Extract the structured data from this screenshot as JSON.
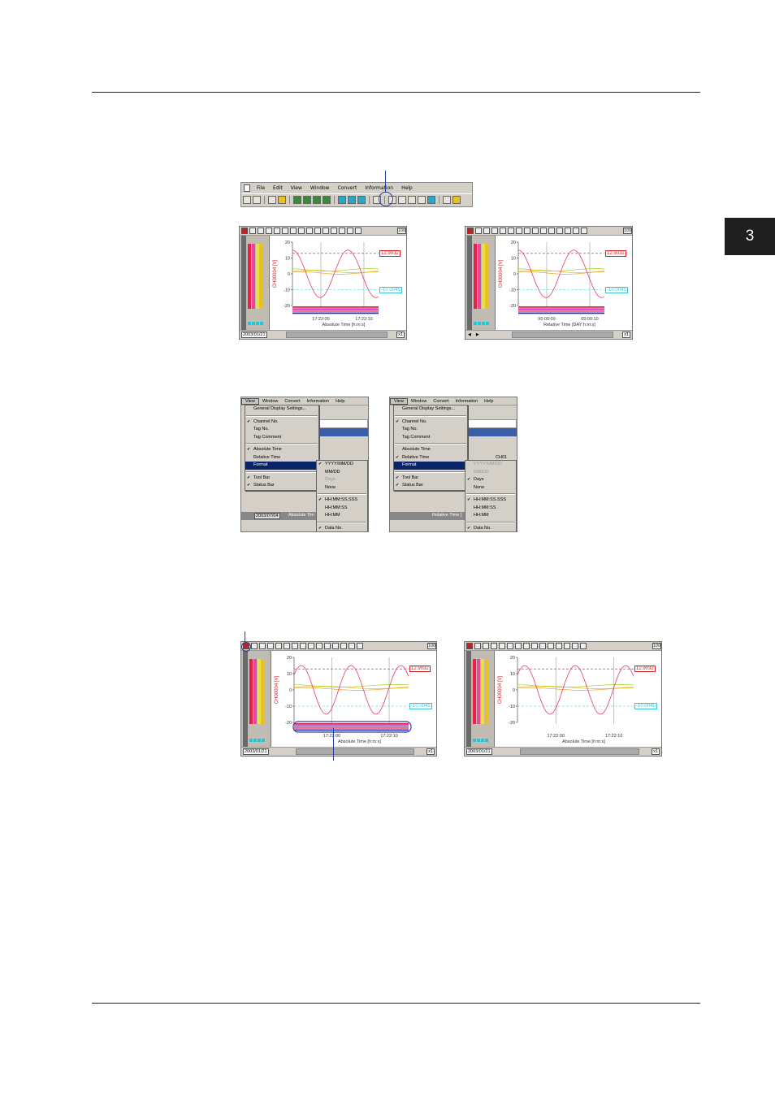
{
  "chapter": "3",
  "menubar": {
    "items": [
      "File",
      "Edit",
      "View",
      "Window",
      "Convert",
      "Information",
      "Help"
    ]
  },
  "panels": {
    "rate": "100msec",
    "y_unit_label": "CH00004 [V]",
    "y_ticks": [
      "20",
      "10",
      "0",
      "-10",
      "-20"
    ],
    "upper_value": "12.9032",
    "lower_value": "-10.0045",
    "date": "2003/01/21",
    "zoom": "x1",
    "abs": {
      "ticks": [
        "17:22:00",
        "17:22:10"
      ],
      "xlabel": "Absolute Time [h:m:s]"
    },
    "rel": {
      "ticks": [
        "00:00:00",
        "00:00:10"
      ],
      "xlabel": "Relative Time [DAY h:m:s]"
    },
    "lower_left_value": "-10.0045"
  },
  "menus": {
    "top_items": [
      "View",
      "Window",
      "Convert",
      "Information",
      "Help"
    ],
    "view_items": [
      "General Display Settings...",
      "Channel No.",
      "Tag No.",
      "Tag Comment",
      "Absolute Time",
      "Relative Time",
      "Format",
      "Tool Bar",
      "Status Bar"
    ],
    "format_items": [
      "YYYY/MM/DD",
      "MM/DD",
      "Days",
      "None",
      "HH:MM:SS.SSS",
      "HH:MM:SS",
      "HH:MM",
      "Data No."
    ],
    "left_status": "2003/07/04 16:05",
    "left_date": "2003/07/04",
    "left_footer": "Absolute Tim",
    "right_ch": "CH01",
    "right_status": "0 00:00:19.400(0",
    "right_footer": "Relative Time ["
  }
}
